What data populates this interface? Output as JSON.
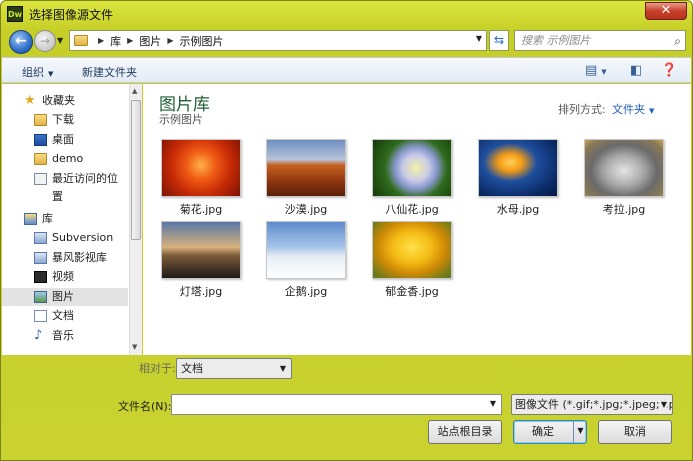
{
  "window": {
    "title": "选择图像源文件",
    "app_icon_text": "Dw"
  },
  "address_bar": {
    "crumbs": [
      "库",
      "图片",
      "示例图片"
    ]
  },
  "search": {
    "placeholder": "搜索 示例图片"
  },
  "toolbar": {
    "organize_label": "组织",
    "new_folder_label": "新建文件夹"
  },
  "nav": {
    "favorites_label": "收藏夹",
    "items_favorites": [
      "下载",
      "桌面",
      "demo",
      "最近访问的位置"
    ],
    "library_label": "库",
    "items_library": [
      "Subversion",
      "暴风影视库",
      "视频",
      "图片",
      "文档",
      "音乐"
    ],
    "selected": "图片"
  },
  "main": {
    "library_title": "图片库",
    "library_subtitle": "示例图片",
    "arrange_label": "排列方式:",
    "arrange_value": "文件夹",
    "files": [
      "菊花.jpg",
      "沙漠.jpg",
      "八仙花.jpg",
      "水母.jpg",
      "考拉.jpg",
      "灯塔.jpg",
      "企鹅.jpg",
      "郁金香.jpg"
    ]
  },
  "bottom": {
    "relative_label": "相对于:",
    "relative_value": "文档",
    "filename_label": "文件名(N):",
    "filename_value": "",
    "filetype_value": "图像文件 (*.gif;*.jpg;*.jpeg;*.p",
    "site_root_label": "站点根目录",
    "ok_label": "确定",
    "cancel_label": "取消"
  },
  "colors": {
    "title_bar": "#c9d22f",
    "library_title": "#1e5e35",
    "link_blue": "#1f5fbf"
  }
}
